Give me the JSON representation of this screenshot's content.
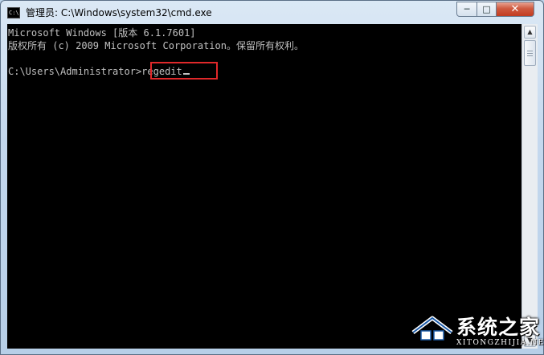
{
  "window": {
    "title": "管理员: C:\\Windows\\system32\\cmd.exe",
    "icon_label": "C:\\",
    "controls": {
      "minimize": "─",
      "maximize": "□",
      "close": "✕"
    }
  },
  "console": {
    "lines": [
      "Microsoft Windows [版本 6.1.7601]",
      "版权所有 (c) 2009 Microsoft Corporation。保留所有权利。"
    ],
    "prompt": "C:\\Users\\Administrator>",
    "command": "regedit"
  },
  "scrollbar": {
    "up": "▲",
    "down": "▼"
  },
  "watermark": {
    "text": "系统之家",
    "url": "XITONGZHIJIA.NET"
  },
  "colors": {
    "console_bg": "#000000",
    "console_text": "#c0c0c0",
    "highlight": "#e0282a",
    "close_button": "#c23b20"
  }
}
